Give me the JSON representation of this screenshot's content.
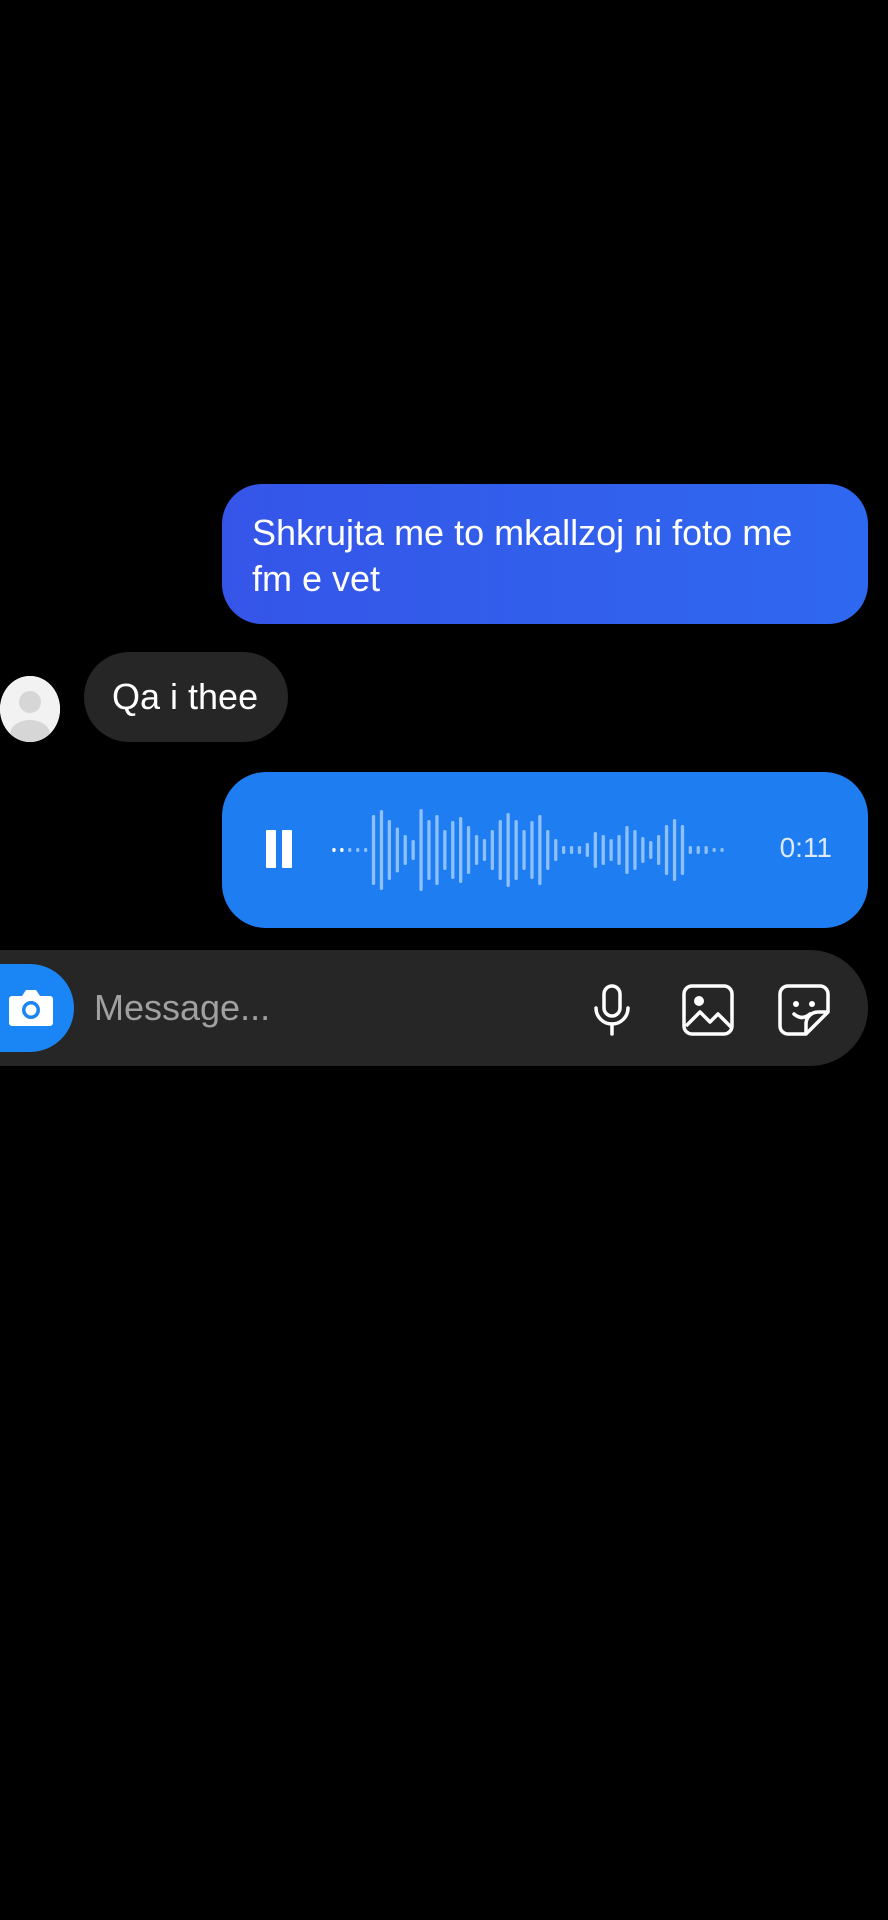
{
  "messages": {
    "sent_text": "Shkrujta me to mkallzoj ni foto me fm e vet",
    "received_text": "Qa i thee",
    "voice": {
      "duration": "0:11",
      "progress": 0.0,
      "icon": "pause-icon"
    }
  },
  "composer": {
    "placeholder": "Message...",
    "icons": [
      "camera-icon",
      "microphone-icon",
      "gallery-icon",
      "sticker-icon"
    ]
  },
  "colors": {
    "background": "#000000",
    "sent_bubble": "#3058ec",
    "voice_bubble": "#1f7df2",
    "received_bubble": "#262626",
    "composer": "#262626",
    "camera_button": "#1a86f5"
  }
}
